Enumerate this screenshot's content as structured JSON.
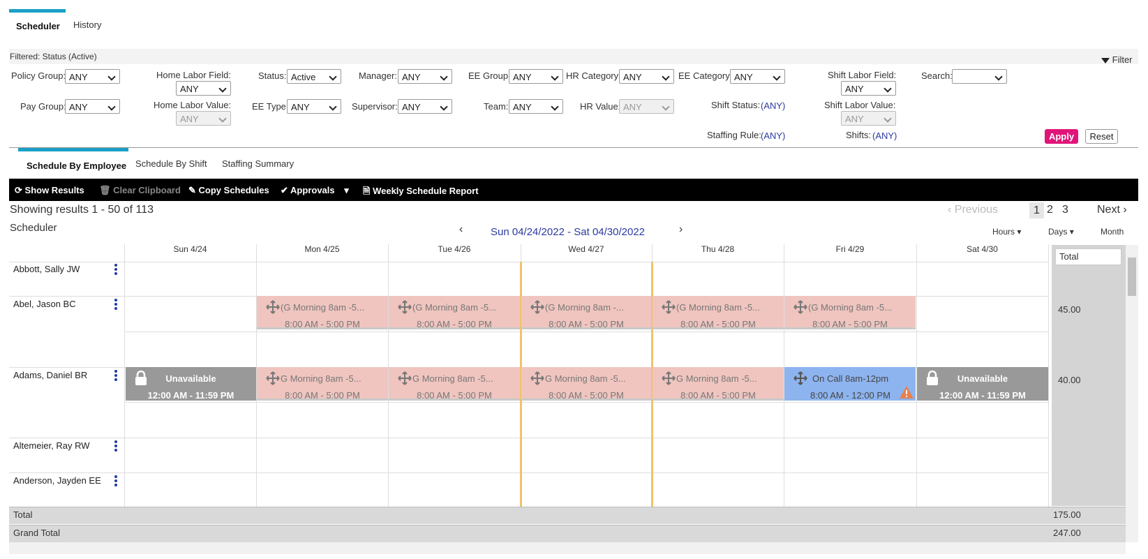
{
  "top_tabs": {
    "scheduler": "Scheduler",
    "history": "History"
  },
  "filter": {
    "filtered_text": "Filtered: Status (Active)",
    "filter_button": "Filter",
    "policy_group_label": "Policy Group:",
    "policy_group_value": "ANY",
    "pay_group_label": "Pay Group:",
    "pay_group_value": "ANY",
    "home_labor_field_label": "Home Labor Field:",
    "home_labor_field_value": "ANY",
    "home_labor_value_label": "Home Labor Value:",
    "home_labor_value_value": "ANY",
    "status_label": "Status:",
    "status_value": "Active",
    "ee_type_label": "EE Type:",
    "ee_type_value": "ANY",
    "manager_label": "Manager:",
    "manager_value": "ANY",
    "supervisor_label": "Supervisor:",
    "supervisor_value": "ANY",
    "ee_group_label": "EE Group:",
    "ee_group_value": "ANY",
    "team_label": "Team:",
    "team_value": "ANY",
    "hr_category_label": "HR Category:",
    "hr_category_value": "ANY",
    "hr_value_label": "HR Value:",
    "hr_value_value": "ANY",
    "ee_category_label": "EE Category:",
    "ee_category_value": "ANY",
    "shift_status_label": "Shift Status:",
    "shift_status_value": "(ANY)",
    "staffing_rule_label": "Staffing Rule:",
    "staffing_rule_value": "(ANY)",
    "shift_labor_field_label": "Shift Labor Field:",
    "shift_labor_field_value": "ANY",
    "shift_labor_value_label": "Shift Labor Value:",
    "shift_labor_value_value": "ANY",
    "shifts_label": "Shifts:",
    "shifts_value": "(ANY)",
    "search_label": "Search:",
    "search_value": "",
    "apply": "Apply",
    "reset": "Reset"
  },
  "sub_tabs": {
    "by_employee": "Schedule By Employee",
    "by_shift": "Schedule By Shift",
    "staffing": "Staffing Summary"
  },
  "toolbar": {
    "show_results": "Show Results",
    "clear_clipboard": "Clear Clipboard",
    "copy_schedules": "Copy Schedules",
    "approvals": "Approvals",
    "weekly_report": "Weekly Schedule Report"
  },
  "results_text": "Showing results 1 - 50 of 113",
  "scheduler_title": "Scheduler",
  "pager": {
    "previous": "Previous",
    "p1": "1",
    "p2": "2",
    "p3": "3",
    "next": "Next"
  },
  "date_range": "Sun 04/24/2022 - Sat 04/30/2022",
  "views": {
    "hours": "Hours",
    "days": "Days",
    "month": "Month"
  },
  "days": [
    "Sun 4/24",
    "Mon 4/25",
    "Tue 4/26",
    "Wed 4/27",
    "Thu 4/28",
    "Fri 4/29",
    "Sat 4/30"
  ],
  "total_header": "Total",
  "employees": [
    "Abbott, Sally JW",
    "Abel, Jason BC",
    "Adams, Daniel BR",
    "Altemeier, Ray RW",
    "Anderson, Jayden EE"
  ],
  "abel_shifts": {
    "mon": "(G Morning 8am -5...",
    "tue": "(G Morning 8am -5...",
    "wed": "(G Morning 8am -...",
    "thu": "(G Morning 8am -5...",
    "fri": "(G Morning 8am -5...",
    "time": "8:00 AM - 5:00 PM"
  },
  "adams_shifts": {
    "unavailable": "Unavailable",
    "unavailable_time": "12:00 AM - 11:59 PM",
    "morning": "G Morning 8am -5...",
    "time": "8:00 AM - 5:00 PM",
    "oncall": "On Call 8am-12pm",
    "oncall_time": "8:00 AM - 12:00 PM"
  },
  "totals": {
    "abel": "45.00",
    "adams": "40.00",
    "total": "175.00",
    "grand_total": "247.00"
  },
  "bottom": {
    "total": "Total",
    "grand_total": "Grand Total"
  }
}
